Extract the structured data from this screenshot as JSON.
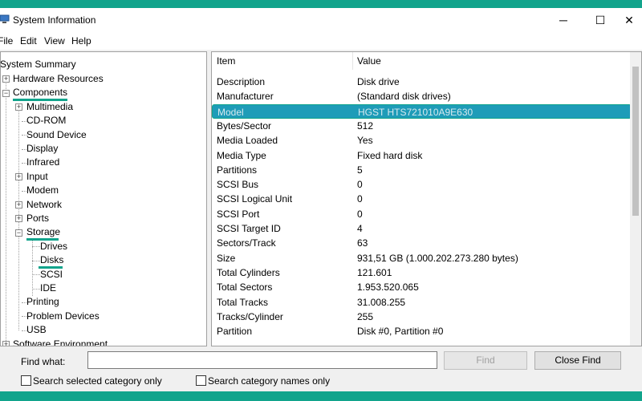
{
  "window": {
    "title": "System Information",
    "minimize_glyph": "─",
    "maximize_glyph": "☐",
    "close_glyph": "✕"
  },
  "menu": {
    "file": "File",
    "edit": "Edit",
    "view": "View",
    "help": "Help"
  },
  "tree": {
    "system_summary": "System Summary",
    "hardware_resources": "Hardware Resources",
    "components": "Components",
    "multimedia": "Multimedia",
    "cdrom": "CD-ROM",
    "sound_device": "Sound Device",
    "display": "Display",
    "infrared": "Infrared",
    "input": "Input",
    "modem": "Modem",
    "network": "Network",
    "ports": "Ports",
    "storage": "Storage",
    "drives": "Drives",
    "disks": "Disks",
    "scsi": "SCSI",
    "ide": "IDE",
    "printing": "Printing",
    "problem_devices": "Problem Devices",
    "usb": "USB",
    "software_environment": "Software Environment"
  },
  "details": {
    "col_item": "Item",
    "col_value": "Value",
    "rows": [
      {
        "item": "Description",
        "value": "Disk drive"
      },
      {
        "item": "Manufacturer",
        "value": "(Standard disk drives)"
      },
      {
        "item": "Model",
        "value": "HGST HTS721010A9E630"
      },
      {
        "item": "Bytes/Sector",
        "value": "512"
      },
      {
        "item": "Media Loaded",
        "value": "Yes"
      },
      {
        "item": "Media Type",
        "value": "Fixed hard disk"
      },
      {
        "item": "Partitions",
        "value": "5"
      },
      {
        "item": "SCSI Bus",
        "value": "0"
      },
      {
        "item": "SCSI Logical Unit",
        "value": "0"
      },
      {
        "item": "SCSI Port",
        "value": "0"
      },
      {
        "item": "SCSI Target ID",
        "value": "4"
      },
      {
        "item": "Sectors/Track",
        "value": "63"
      },
      {
        "item": "Size",
        "value": "931,51 GB (1.000.202.273.280 bytes)"
      },
      {
        "item": "Total Cylinders",
        "value": "121.601"
      },
      {
        "item": "Total Sectors",
        "value": "1.953.520.065"
      },
      {
        "item": "Total Tracks",
        "value": "31.008.255"
      },
      {
        "item": "Tracks/Cylinder",
        "value": "255"
      },
      {
        "item": "Partition",
        "value": "Disk #0, Partition #0"
      }
    ]
  },
  "find": {
    "label": "Find what:",
    "value": "",
    "find_button": "Find",
    "close_find_button": "Close Find",
    "search_selected_label": "Search selected category only",
    "search_names_label": "Search category names only"
  },
  "colors": {
    "accent": "#12a48c",
    "selection": "#1e9cb8"
  },
  "icons": {
    "app": "monitor-icon",
    "expand": "plus-expander-icon",
    "collapse": "minus-expander-icon"
  }
}
